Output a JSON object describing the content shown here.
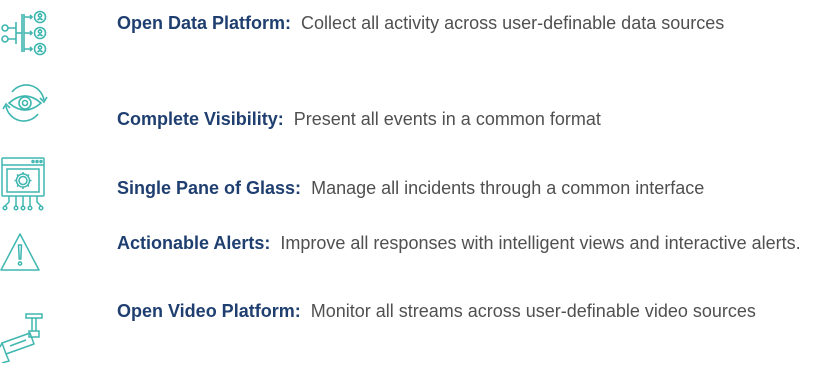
{
  "features": [
    {
      "icon": "data-sources-icon",
      "title": "Open Data Platform:",
      "description": "Collect all activity across user-definable data sources"
    },
    {
      "icon": "eye-visibility-icon",
      "title": "Complete Visibility:",
      "description": "Present all events in a common format"
    },
    {
      "icon": "gear-window-icon",
      "title": "Single Pane of Glass:",
      "description": "Manage all incidents through a common interface"
    },
    {
      "icon": "warning-triangle-icon",
      "title": "Actionable Alerts:",
      "description": "Improve all responses with intelligent views and interactive alerts."
    },
    {
      "icon": "security-camera-icon",
      "title": "Open Video Platform:",
      "description": "Monitor all streams across user-definable video sources"
    }
  ],
  "colors": {
    "icon": "#3fb6b0",
    "title": "#1f3f70",
    "text": "#505050"
  }
}
